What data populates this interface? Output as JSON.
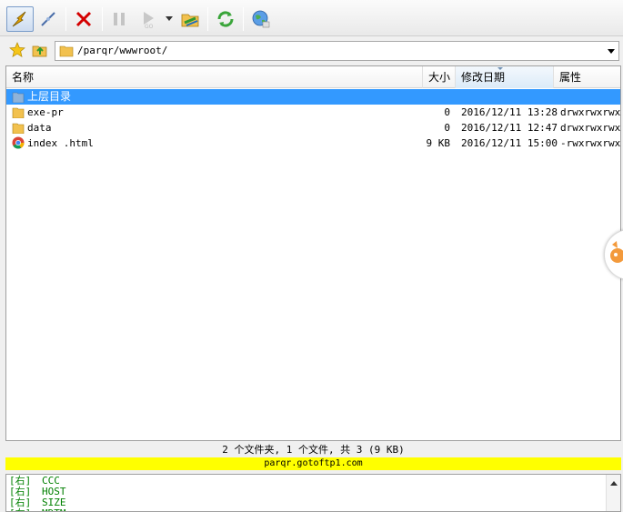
{
  "toolbar": {
    "buttons": [
      {
        "name": "connect",
        "icon": "lightning-plug-icon",
        "active": true
      },
      {
        "name": "disconnect",
        "icon": "unplugged-icon",
        "active": false
      },
      {
        "name": "stop",
        "icon": "red-x-icon",
        "active": false
      },
      {
        "name": "pause",
        "icon": "pause-icon",
        "active": false
      },
      {
        "name": "transfer",
        "icon": "play-icon",
        "active": false
      },
      {
        "name": "transfer-options",
        "icon": "chevron-down-icon",
        "active": false
      },
      {
        "name": "site-manager",
        "icon": "folder-sync-icon",
        "active": false
      },
      {
        "name": "refresh",
        "icon": "refresh-icon",
        "active": false
      },
      {
        "name": "web",
        "icon": "globe-icon",
        "active": false
      }
    ]
  },
  "address": {
    "path": "/parqr/wwwroot/"
  },
  "columns": {
    "name": "名称",
    "size": "大小",
    "date": "修改日期",
    "attr": "属性"
  },
  "files": [
    {
      "name": "上层目录",
      "size": "",
      "date": "",
      "attr": "",
      "icon": "parent-folder-icon",
      "selected": true
    },
    {
      "name": "exe-pr",
      "size": "0",
      "date": "2016/12/11 13:28",
      "attr": "drwxrwxrwx",
      "icon": "folder-icon",
      "selected": false
    },
    {
      "name": "data",
      "size": "0",
      "date": "2016/12/11 12:47",
      "attr": "drwxrwxrwx",
      "icon": "folder-icon",
      "selected": false
    },
    {
      "name": "index .html",
      "size": "9 KB",
      "date": "2016/12/11 15:00",
      "attr": "-rwxrwxrwx",
      "icon": "chrome-icon",
      "selected": false
    }
  ],
  "status": {
    "summary": "2 个文件夹, 1 个文件, 共 3 (9 KB)",
    "host": "parqr.gotoftp1.com"
  },
  "log": [
    {
      "tag": "[右]",
      "text": "CCC"
    },
    {
      "tag": "[右]",
      "text": "HOST"
    },
    {
      "tag": "[右]",
      "text": "SIZE"
    },
    {
      "tag": "[右]",
      "text": "MDTM"
    }
  ],
  "colors": {
    "selection": "#3399ff",
    "host_bar": "#ffff00",
    "log_text": "#008000"
  }
}
